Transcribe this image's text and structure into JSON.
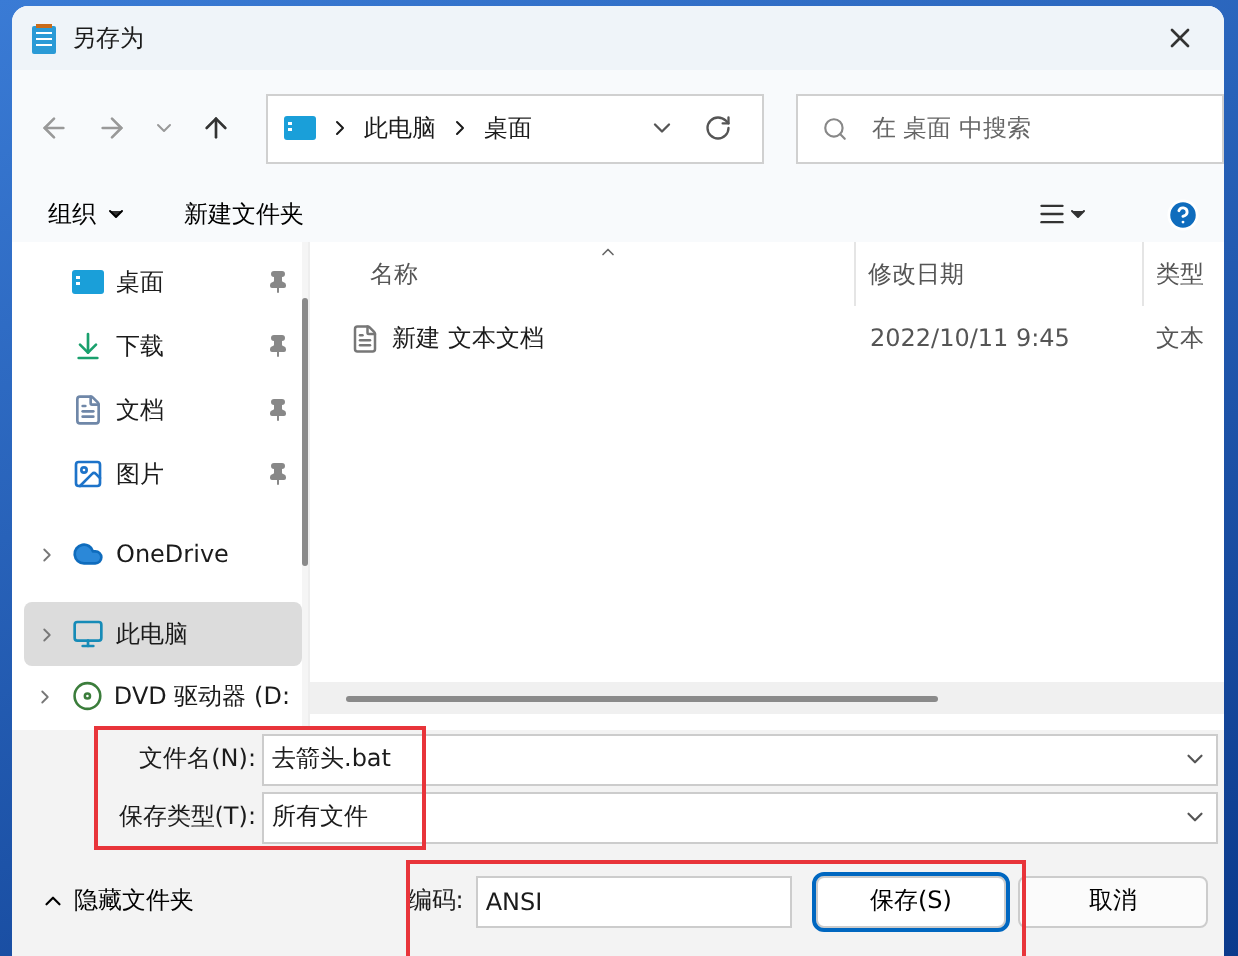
{
  "window": {
    "title": "另存为"
  },
  "address_bar": {
    "path": [
      "此电脑",
      "桌面"
    ]
  },
  "search": {
    "placeholder": "在 桌面 中搜索"
  },
  "toolbar": {
    "organize": "组织",
    "new_folder": "新建文件夹"
  },
  "nav_items": [
    {
      "label": "桌面",
      "kind": "desktop",
      "pinned": true,
      "expandable": false,
      "selected": false
    },
    {
      "label": "下载",
      "kind": "download",
      "pinned": true,
      "expandable": false,
      "selected": false
    },
    {
      "label": "文档",
      "kind": "document",
      "pinned": true,
      "expandable": false,
      "selected": false
    },
    {
      "label": "图片",
      "kind": "pictures",
      "pinned": true,
      "expandable": false,
      "selected": false
    },
    {
      "label": "OneDrive",
      "kind": "cloud",
      "pinned": false,
      "expandable": true,
      "selected": false
    },
    {
      "label": "此电脑",
      "kind": "computer",
      "pinned": false,
      "expandable": true,
      "selected": true
    },
    {
      "label": "DVD 驱动器 (D:",
      "kind": "drive",
      "pinned": false,
      "expandable": true,
      "selected": false
    }
  ],
  "table": {
    "columns": [
      "名称",
      "修改日期",
      "类型"
    ],
    "rows": [
      {
        "name": "新建 文本文档",
        "date": "2022/10/11 9:45",
        "type": "文本"
      }
    ]
  },
  "form": {
    "file_name_label": "文件名(N):",
    "file_name": "去箭头.bat",
    "type_label": "保存类型(T):",
    "type": "所有文件"
  },
  "footer": {
    "hide_folders": "隐藏文件夹",
    "encoding_label": "编码:",
    "encoding": "ANSI",
    "buttons": [
      "保存(S)",
      "取消"
    ]
  }
}
